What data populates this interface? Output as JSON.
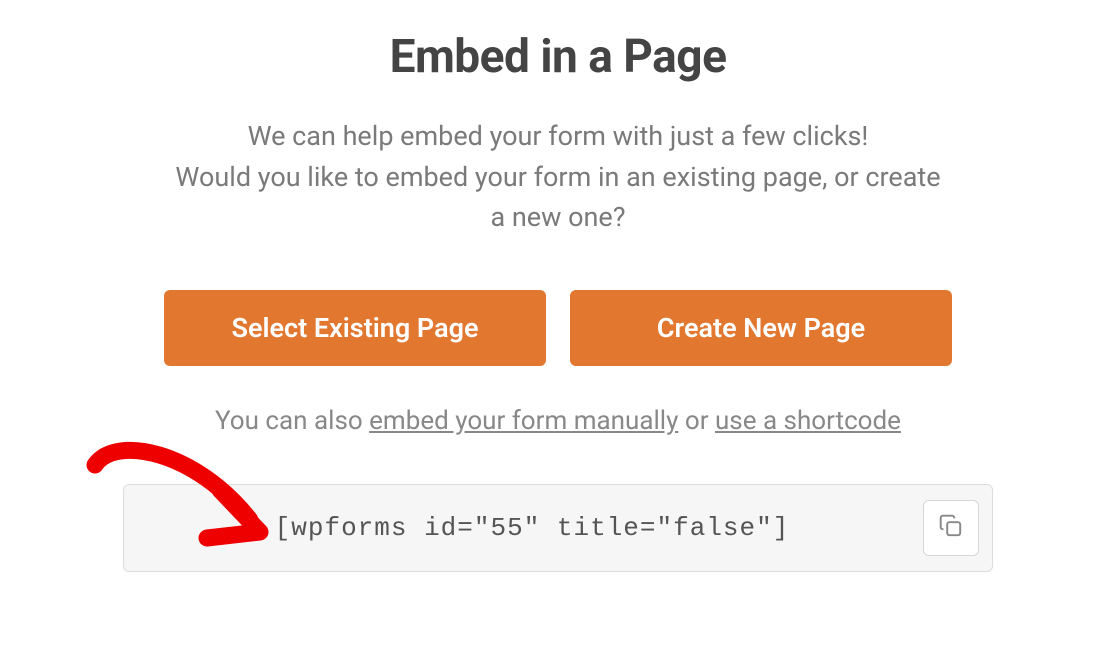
{
  "title": "Embed in a Page",
  "subtitle": {
    "line1": "We can help embed your form with just a few clicks!",
    "line2": "Would you like to embed your form in an existing page, or create",
    "line3": "a new one?"
  },
  "buttons": {
    "selectExisting": "Select Existing Page",
    "createNew": "Create New Page"
  },
  "helperText": {
    "prefix": "You can also ",
    "linkManual": "embed your form manually",
    "middle": " or ",
    "linkShortcode": "use a shortcode"
  },
  "shortcode": "[wpforms id=\"55\" title=\"false\"]"
}
